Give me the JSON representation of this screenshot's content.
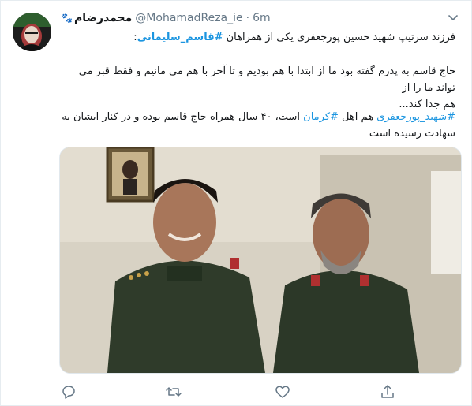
{
  "tweet": {
    "author_name": "محمدرضام",
    "handle": "@MohamadReza_ie",
    "separator": "·",
    "time": "6m",
    "p1_text": "فرزند سرتیپ شهید حسین پورجعفری یکی از همراهان ",
    "p1_hashtag": "#قاسم_سلیمانی",
    "p1_end": ":",
    "p2_line1": "حاج قاسم به پدرم گفته بود ما از ابتدا با هم بودیم و تا آخر با هم می مانیم و فقط قبر می تواند ما را از",
    "p2_line2": "هم جدا کند...",
    "p3_hashtag1": "#شهید_پورجعفری",
    "p3_mid": " هم اهل ",
    "p3_hashtag2": "#کرمان",
    "p3_rest": " است، ۴۰ سال همراه حاج قاسم بوده و در کنار ایشان به",
    "p3_line2": "شهادت رسیده است"
  },
  "icons": {
    "avatar": "avatar",
    "paws": "paw-prints-icon",
    "more": "chevron-down-icon",
    "reply": "reply-icon",
    "retweet": "retweet-icon",
    "like": "like-icon",
    "share": "share-icon"
  },
  "colors": {
    "link": "#1b95e0",
    "muted": "#657786",
    "text": "#14171a",
    "border": "#e6ecf0"
  }
}
